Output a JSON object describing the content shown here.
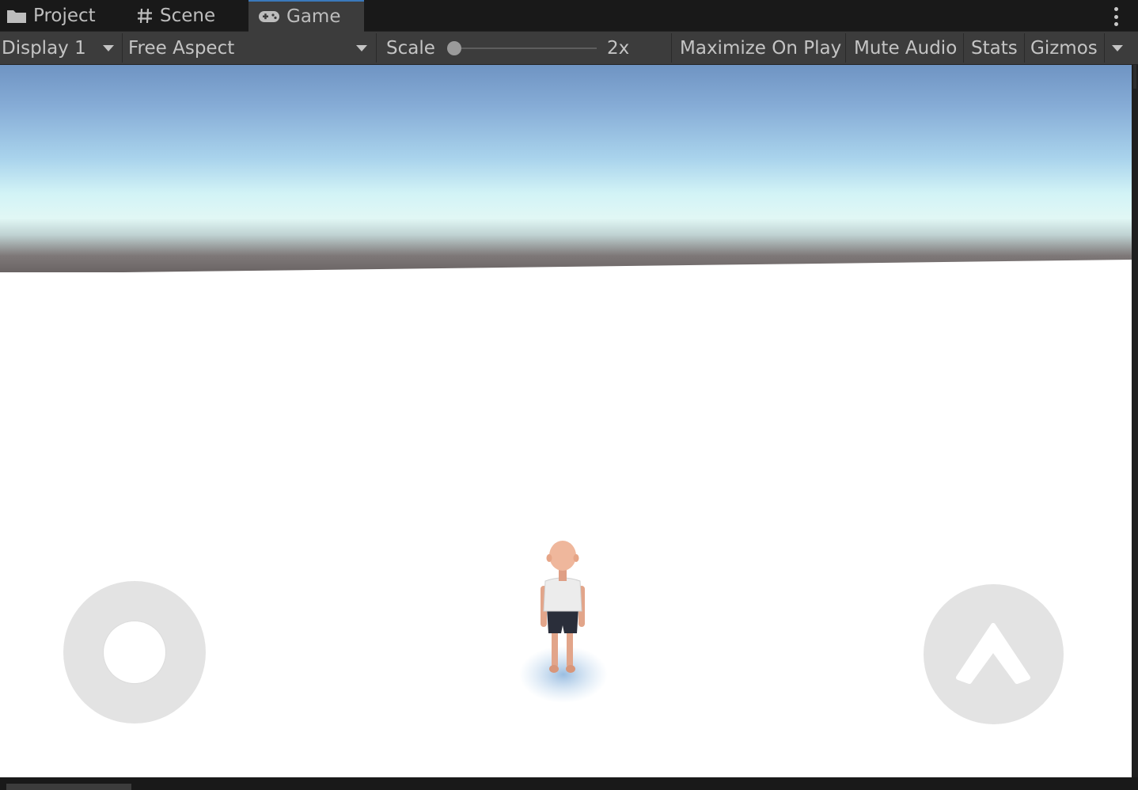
{
  "tabs": [
    {
      "label": "Project",
      "icon": "folder-icon",
      "active": false
    },
    {
      "label": "Scene",
      "icon": "hash-grid-icon",
      "active": false
    },
    {
      "label": "Game",
      "icon": "gamepad-icon",
      "active": true
    }
  ],
  "toolbar": {
    "display": "Display 1",
    "aspect": "Free Aspect",
    "scale_label": "Scale",
    "scale_value": "2x",
    "maximize_on_play": "Maximize On Play",
    "mute_audio": "Mute Audio",
    "stats": "Stats",
    "gizmos": "Gizmos"
  },
  "colors": {
    "editor_bg": "#191919",
    "toolbar_bg": "#3c3c3c",
    "active_tab_accent": "#3a79bb",
    "control_gray": "#e3e3e3"
  },
  "game": {
    "joystick_icon": "joystick-icon",
    "jump_icon": "chevron-up-icon"
  }
}
